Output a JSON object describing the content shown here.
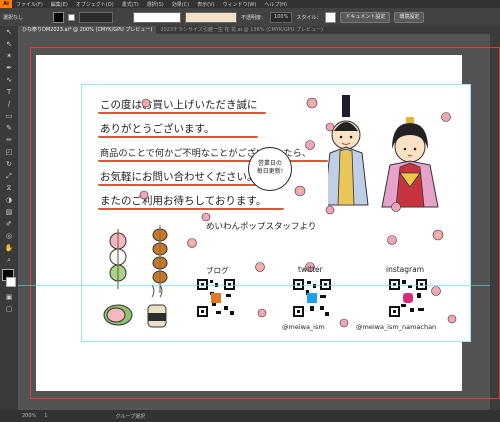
{
  "menubar": {
    "items": [
      "ファイル(F)",
      "編集(E)",
      "オブジェクト(O)",
      "書式(T)",
      "選択(S)",
      "効果(C)",
      "表示(V)",
      "ウィンドウ(W)",
      "ヘルプ(H)"
    ],
    "app_icon": "Ai"
  },
  "control_bar": {
    "selection_label": "選択なし",
    "opacity_label": "不透明度：",
    "opacity_value": "100%",
    "style_label": "スタイル：",
    "doc_setup_button": "ドキュメント設定",
    "preferences_button": "環境設定"
  },
  "tabs": [
    {
      "label": "ひな祭りDM2023.ai* @ 200% (CMYK/GPU プレビュー)",
      "active": true
    },
    {
      "label": "2023チラシサイズ引越一生 花 花.ai @ 136% (CMYK/GPU プレビュー)",
      "active": false
    }
  ],
  "status_bar": {
    "zoom": "200%",
    "page": "1",
    "mode": "グループ選択"
  },
  "card": {
    "lines": [
      "この度はお買い上げいただき誠に",
      "ありがとうございます。",
      "商品のことで何かご不明なことがございましたら、",
      "お気軽にお問い合わせください。",
      "またのご利用お待ちしております。"
    ],
    "signature": "めいわんポップスタッフより",
    "bubble_lines": [
      "営業日の",
      "毎日更新!"
    ],
    "blog_label": "ブログ",
    "twitter_label": "twitter",
    "instagram_label": "instagram",
    "twitter_handle": "@meiwa_ism",
    "instagram_handle": "@meiwa_ism_namachan"
  },
  "colors": {
    "accent_underline": "#e4572e",
    "flower_pink": "#f0a7b5",
    "guide_cyan": "#5fd8e8",
    "artboard_border": "#d84040"
  }
}
